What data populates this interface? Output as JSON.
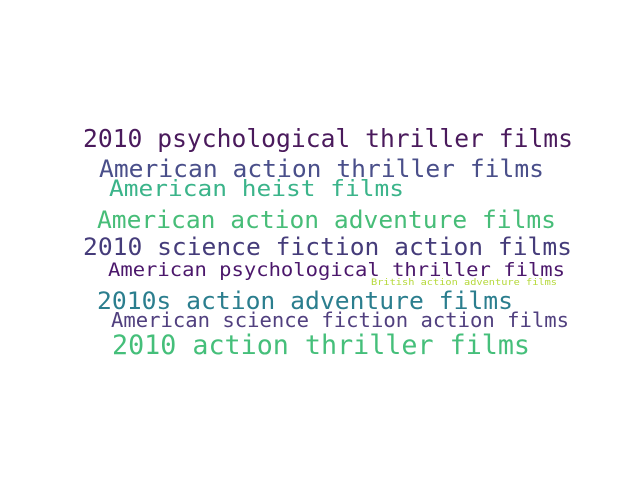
{
  "words": [
    {
      "text": "2010 psychological thriller films",
      "color": "#4a1a5c"
    },
    {
      "text": "American action thriller films",
      "color": "#4a4f8a"
    },
    {
      "text": "American heist films",
      "color": "#3bb48a"
    },
    {
      "text": "American action adventure films",
      "color": "#47bd78"
    },
    {
      "text": "2010 science fiction action films",
      "color": "#453c7a"
    },
    {
      "text": "American psychological thriller films",
      "color": "#4b176b"
    },
    {
      "text": "British action adventure films",
      "color": "#b5d93a"
    },
    {
      "text": "2010s action adventure films",
      "color": "#2b7e8e"
    },
    {
      "text": "American science fiction action films",
      "color": "#51407f"
    },
    {
      "text": "2010 action thriller films",
      "color": "#45bf7a"
    }
  ]
}
